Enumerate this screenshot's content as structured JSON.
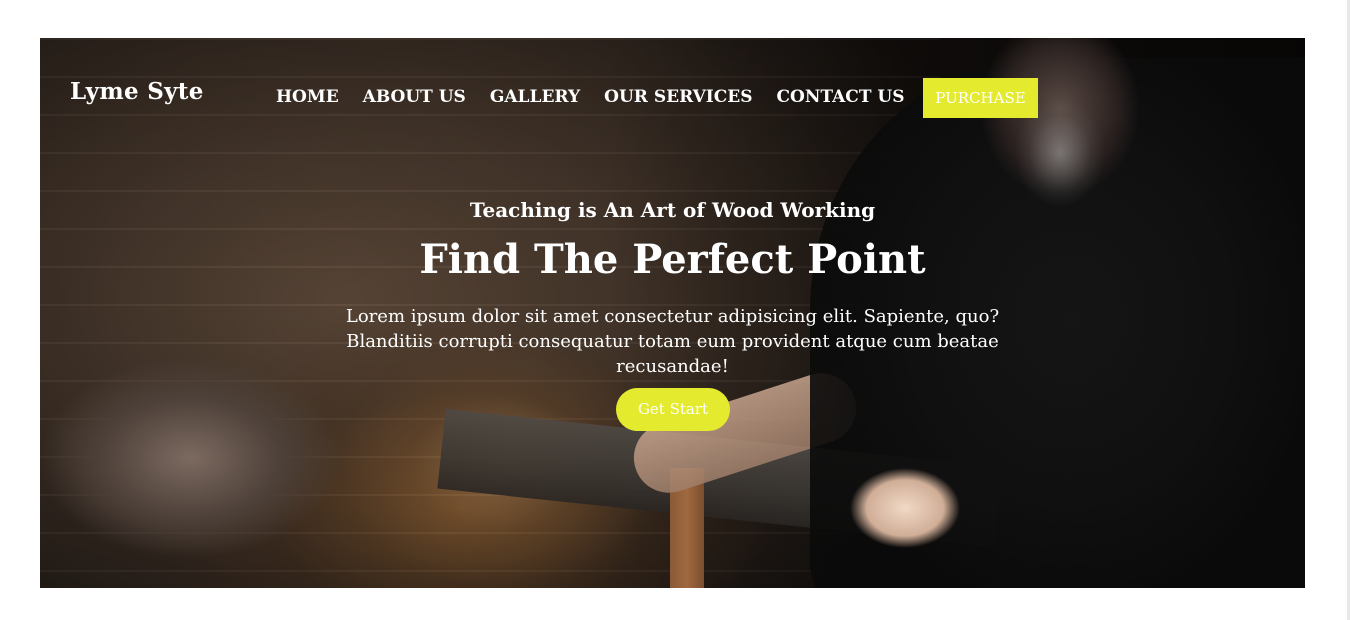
{
  "brand": {
    "name": "Lyme Syte"
  },
  "nav": {
    "items": [
      {
        "label": "HOME"
      },
      {
        "label": "ABOUT US"
      },
      {
        "label": "GALLERY"
      },
      {
        "label": "OUR SERVICES"
      },
      {
        "label": "CONTACT US"
      }
    ],
    "purchase_label": "PURCHASE"
  },
  "hero": {
    "subtitle": "Teaching is An Art of Wood Working",
    "title": "Find The Perfect Point",
    "description": "Lorem ipsum dolor sit amet consectetur adipisicing elit. Sapiente, quo? Blanditiis corrupti consequatur totam eum provident atque cum beatae recusandae!",
    "cta_label": "Get Start",
    "background_image": "woodworker-sawing-photo"
  },
  "colors": {
    "accent": "#e4ea2e",
    "text": "#ffffff",
    "page_background": "#ffffff"
  }
}
